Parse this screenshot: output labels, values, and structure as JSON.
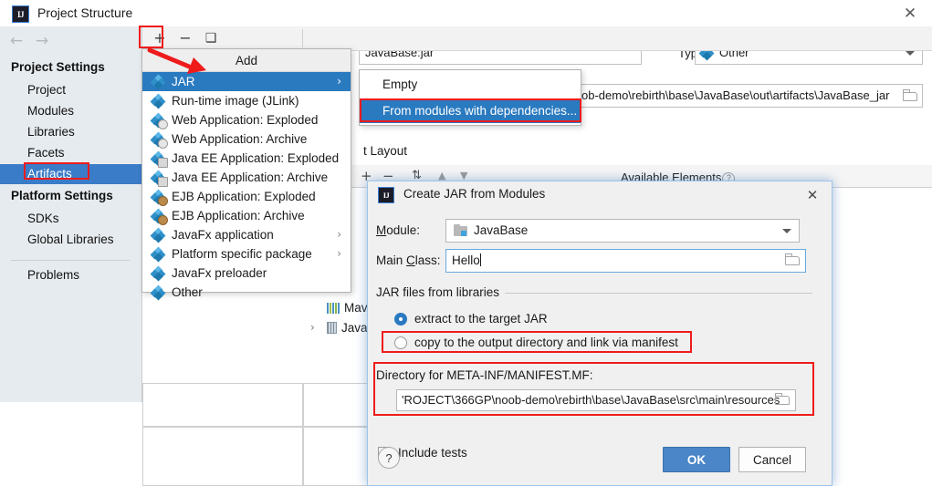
{
  "window": {
    "title": "Project Structure",
    "logo_text": "IJ",
    "close_icon": "✕"
  },
  "nav": {
    "back_icon": "←",
    "forward_icon": "→",
    "groups": [
      {
        "title": "Project Settings",
        "items": [
          {
            "label": "Project",
            "selected": false
          },
          {
            "label": "Modules",
            "selected": false
          },
          {
            "label": "Libraries",
            "selected": false
          },
          {
            "label": "Facets",
            "selected": false
          },
          {
            "label": "Artifacts",
            "selected": true
          }
        ]
      },
      {
        "title": "Platform Settings",
        "items": [
          {
            "label": "SDKs",
            "selected": false
          },
          {
            "label": "Global Libraries",
            "selected": false
          }
        ]
      }
    ],
    "problems_label": "Problems"
  },
  "toolbar": {
    "add_icon": "+",
    "remove_icon": "−",
    "copy_icon": "❏"
  },
  "artifact": {
    "name_value": "JavaBase:jar",
    "type_label": "Type:",
    "type_value": "Other",
    "output_dir_value": "ob-demo\\rebirth\\base\\JavaBase\\out\\artifacts\\JavaBase_jar",
    "layout_label": "t Layout",
    "available_elements_label": "Available Elements",
    "help_badge": "?",
    "tree": [
      {
        "label": "Mav",
        "icon": "maven-icon",
        "expander": ""
      },
      {
        "label": "Java",
        "icon": "jar-icon",
        "expander": "›"
      }
    ],
    "bg_toolbar_icons": [
      "+",
      "−",
      "⇅",
      "▲",
      "▼"
    ]
  },
  "add_menu": {
    "header": "Add",
    "items": [
      {
        "label": "JAR",
        "icon": "diamond-icon",
        "submenu": true,
        "active": true
      },
      {
        "label": "Run-time image (JLink)",
        "icon": "diamond-icon",
        "submenu": false,
        "active": false
      },
      {
        "label": "Web Application: Exploded",
        "icon": "diamond-web-icon",
        "submenu": false,
        "active": false
      },
      {
        "label": "Web Application: Archive",
        "icon": "diamond-web-icon",
        "submenu": false,
        "active": false
      },
      {
        "label": "Java EE Application: Exploded",
        "icon": "diamond-ee-icon",
        "submenu": false,
        "active": false
      },
      {
        "label": "Java EE Application: Archive",
        "icon": "diamond-ee-icon",
        "submenu": false,
        "active": false
      },
      {
        "label": "EJB Application: Exploded",
        "icon": "diamond-ejb-icon",
        "submenu": false,
        "active": false
      },
      {
        "label": "EJB Application: Archive",
        "icon": "diamond-ejb-icon",
        "submenu": false,
        "active": false
      },
      {
        "label": "JavaFx application",
        "icon": "diamond-icon",
        "submenu": true,
        "active": false
      },
      {
        "label": "Platform specific package",
        "icon": "diamond-icon",
        "submenu": true,
        "active": false
      },
      {
        "label": "JavaFx preloader",
        "icon": "diamond-icon",
        "submenu": false,
        "active": false
      },
      {
        "label": "Other",
        "icon": "diamond-icon",
        "submenu": false,
        "active": false
      }
    ],
    "submenu_caret": "›"
  },
  "jar_submenu": {
    "items": [
      {
        "label": "Empty",
        "active": false
      },
      {
        "label": "From modules with dependencies...",
        "active": true
      }
    ]
  },
  "jar_dialog": {
    "title": "Create JAR from Modules",
    "logo_text": "IJ",
    "close_icon": "✕",
    "module_label": "Module:",
    "module_value": "JavaBase",
    "main_class_label": "Main Class:",
    "main_class_value": "Hello",
    "group_label": "JAR files from libraries",
    "radio_extract": "extract to the target JAR",
    "radio_copy": "copy to the output directory and link via manifest",
    "radio_selected": "extract",
    "directory_label": "Directory for META-INF/MANIFEST.MF:",
    "directory_value": "'ROJECT\\366GP\\noob-demo\\rebirth\\base\\JavaBase\\src\\main\\resources",
    "include_tests_label": "Include tests",
    "include_tests_checked": false,
    "help_label": "?",
    "ok_label": "OK",
    "cancel_label": "Cancel"
  },
  "colors": {
    "accent_blue": "#2a7ac0",
    "selection_blue": "#3a7cc7",
    "annotation_red": "#ef1b1b",
    "ok_button": "#4a86c8",
    "panel_bg": "#f0f0f0",
    "nav_bg": "#e6ebef"
  }
}
